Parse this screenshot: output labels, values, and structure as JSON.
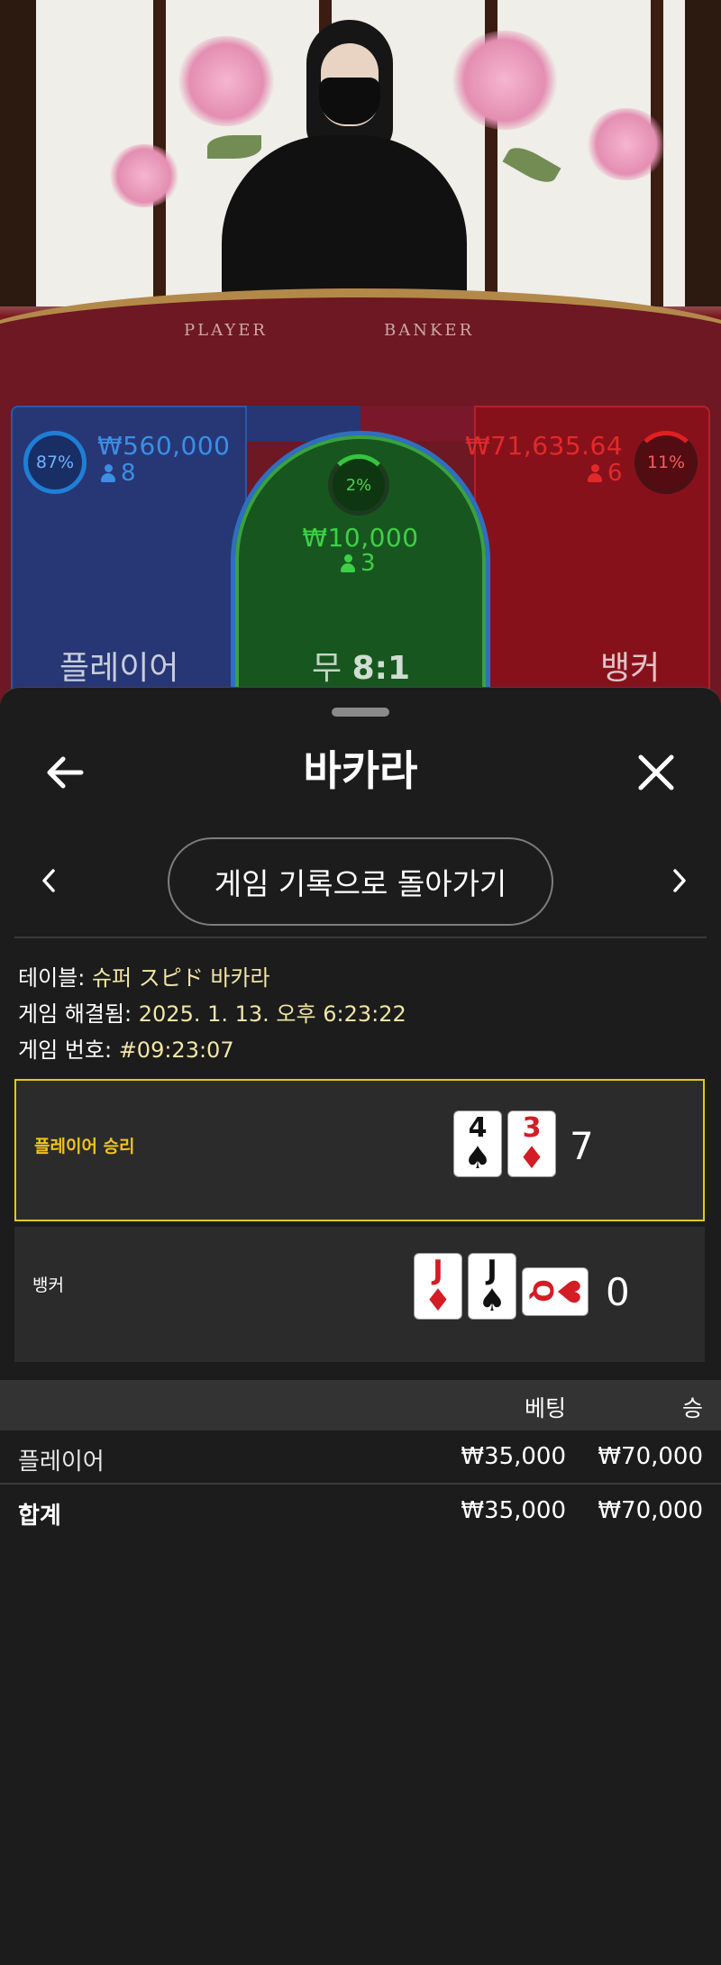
{
  "table_view": {
    "felt_labels": {
      "player": "PLAYER",
      "banker": "BANKER"
    },
    "player": {
      "percent": "87%",
      "amount": "₩560,000",
      "players": "8",
      "label": "플레이어"
    },
    "tie": {
      "percent": "2%",
      "amount": "₩10,000",
      "players": "3",
      "label": "무",
      "payout": "8:1"
    },
    "banker": {
      "percent": "11%",
      "amount": "₩71,635.64",
      "players": "6",
      "label": "뱅커"
    },
    "colors": {
      "player": "#1f7fd6",
      "tie": "#36c43c",
      "banker": "#e02020"
    }
  },
  "sheet": {
    "title": "바카라",
    "back_icon": "arrow-left-icon",
    "close_icon": "close-icon",
    "history_button": "게임 기록으로 돌아가기",
    "prev_icon": "chevron-left-icon",
    "next_icon": "chevron-right-icon"
  },
  "game_info": {
    "table_label": "테이블:",
    "table_value": "슈퍼 スピド 바카라",
    "resolved_label": "게임 해결됨:",
    "resolved_value": "2025. 1. 13. 오후 6:23:22",
    "number_label": "게임 번호:",
    "number_value": "#09:23:07"
  },
  "results": {
    "player": {
      "label": "플레이어 승리",
      "score": "7",
      "cards": [
        {
          "rank": "4",
          "suit": "♠",
          "color": "black"
        },
        {
          "rank": "3",
          "suit": "♦",
          "color": "red"
        }
      ]
    },
    "banker": {
      "label": "뱅커",
      "score": "0",
      "cards": [
        {
          "rank": "J",
          "suit": "♦",
          "color": "red"
        },
        {
          "rank": "J",
          "suit": "♠",
          "color": "black"
        },
        {
          "rank": "Q",
          "suit": "♥",
          "color": "red",
          "sideways": true
        }
      ]
    },
    "highlight_color": "#e6c619"
  },
  "bets": {
    "headers": {
      "bet": "베팅",
      "win": "승"
    },
    "rows": [
      {
        "name": "플레이어",
        "bet": "₩35,000",
        "win": "₩70,000"
      }
    ],
    "total": {
      "name": "합계",
      "bet": "₩35,000",
      "win": "₩70,000"
    }
  }
}
